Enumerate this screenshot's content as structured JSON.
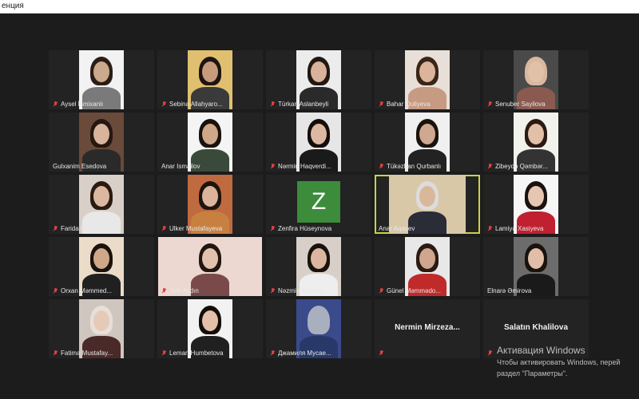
{
  "window": {
    "title": "енция"
  },
  "participants": [
    {
      "name": "Aysel İsmixanlı",
      "muted": true,
      "type": "video"
    },
    {
      "name": "Sebina Allahyaro...",
      "muted": true,
      "type": "video"
    },
    {
      "name": "Türkan Aslanbeyli",
      "muted": true,
      "type": "video"
    },
    {
      "name": "Bahar Quliyeva",
      "muted": true,
      "type": "video"
    },
    {
      "name": "Senuber Sayilova",
      "muted": true,
      "type": "video"
    },
    {
      "name": "Gulxanim Esedova",
      "muted": false,
      "type": "video"
    },
    {
      "name": "Anar Ismailov",
      "muted": false,
      "type": "video"
    },
    {
      "name": "Nərmin Haqverdi...",
      "muted": true,
      "type": "video"
    },
    {
      "name": "Tükəzban Qurbanlı",
      "muted": true,
      "type": "video"
    },
    {
      "name": "Zibeydə Qəmbər...",
      "muted": true,
      "type": "video"
    },
    {
      "name": "Farida Mamedova",
      "muted": true,
      "type": "video"
    },
    {
      "name": "Ulker Mustafayeva",
      "muted": true,
      "type": "video"
    },
    {
      "name": "Zenfira Hüseynova",
      "muted": true,
      "type": "avatar",
      "initial": "Z"
    },
    {
      "name": "Anar Aqayev",
      "muted": false,
      "type": "video",
      "active_speaker": true
    },
    {
      "name": "Lamiyə Xasiyeva",
      "muted": true,
      "type": "video"
    },
    {
      "name": "Orxan Məmmed...",
      "muted": true,
      "type": "video"
    },
    {
      "name": "Jalə Aydın",
      "muted": true,
      "type": "video"
    },
    {
      "name": "Nəzmin Allahver...",
      "muted": true,
      "type": "video"
    },
    {
      "name": "Günel Məmmədo...",
      "muted": true,
      "type": "video"
    },
    {
      "name": "Elnarə Əmirova",
      "muted": false,
      "type": "video"
    },
    {
      "name": "Fatimə Mustafay...",
      "muted": true,
      "type": "video"
    },
    {
      "name": "Leman Humbetova",
      "muted": true,
      "type": "video"
    },
    {
      "name": "Джамиля Мусае...",
      "muted": true,
      "type": "video"
    },
    {
      "name": "Nermin  Mirzeza...",
      "muted": true,
      "type": "name_only"
    },
    {
      "name": "Salatın Khalilova",
      "muted": true,
      "type": "name_only"
    }
  ],
  "watermark": {
    "line1": "Активация Windows",
    "line2": "Чтобы активировать Windows, перей",
    "line3": "раздел \"Параметры\"."
  },
  "colors": {
    "background": "#1c1c1c",
    "tile": "#232323",
    "active_border": "#c7d34b",
    "muted_icon": "#e04040",
    "avatar_green": "#3c8c3c"
  }
}
